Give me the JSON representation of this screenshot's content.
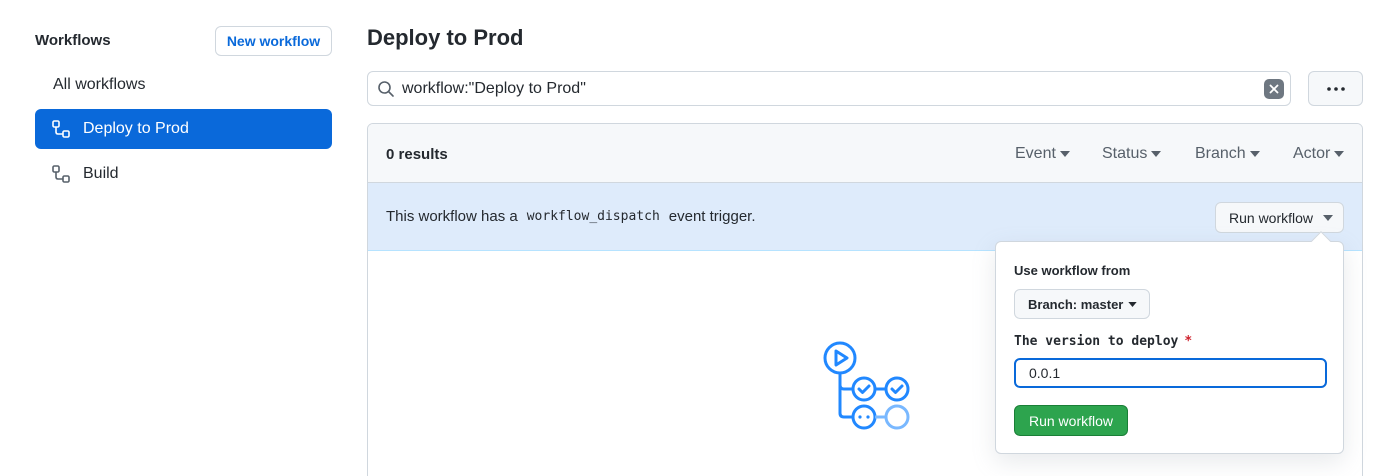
{
  "sidebar": {
    "title": "Workflows",
    "new_workflow_label": "New workflow",
    "items": [
      {
        "label": "All workflows",
        "icon": "none",
        "selected": false
      },
      {
        "label": "Deploy to Prod",
        "icon": "workflow-icon",
        "selected": true
      },
      {
        "label": "Build",
        "icon": "workflow-icon",
        "selected": false
      }
    ]
  },
  "main": {
    "title": "Deploy to Prod",
    "search": {
      "value": "workflow:\"Deploy to Prod\"",
      "icon": "search-icon",
      "clear_icon": "close-icon"
    },
    "more_icon": "kebab-horizontal-icon",
    "results": {
      "count_label": "0 results",
      "filters": [
        "Event",
        "Status",
        "Branch",
        "Actor"
      ]
    },
    "dispatch": {
      "text_before": "This workflow has a",
      "code": "workflow_dispatch",
      "text_after": "event trigger.",
      "run_button_label": "Run workflow"
    },
    "empty_illustration": "workflow-graph-icon"
  },
  "popover": {
    "use_from_label": "Use workflow from",
    "branch_select_label": "Branch: master",
    "version_label": "The version to deploy",
    "required_marker": "*",
    "version_value": "0.0.1",
    "submit_label": "Run workflow"
  },
  "colors": {
    "accent_blue": "#0a69da",
    "banner_blue": "#deebfb",
    "green": "#2da44e",
    "danger_red": "#cf222e",
    "illustration_blue": "#2188ff"
  }
}
